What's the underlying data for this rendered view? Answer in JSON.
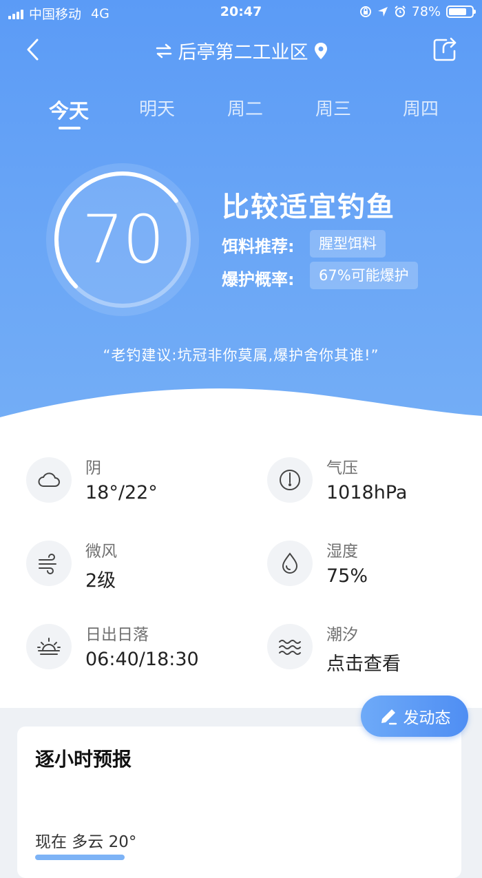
{
  "status_bar": {
    "carrier": "中国移动",
    "network": "4G",
    "time": "20:47",
    "battery": "78%",
    "battery_level": 0.78
  },
  "nav": {
    "location": "后亭第二工业区"
  },
  "tabs": [
    "今天",
    "明天",
    "周二",
    "周三",
    "周四"
  ],
  "active_tab": 0,
  "score": {
    "value": "70",
    "level": 0.7
  },
  "verdict": "比较适宜钓鱼",
  "bait": {
    "label": "饵料推荐:",
    "value": "腥型饵料"
  },
  "blank_rate": {
    "label": "爆护概率:",
    "value": "67%可能爆护"
  },
  "quote": "“老钓建议:坑冠非你莫属,爆护舍你其谁!”",
  "conditions": [
    {
      "icon": "cloud-icon",
      "label": "阴",
      "value": "18°/22°"
    },
    {
      "icon": "pressure-gauge-icon",
      "label": "气压",
      "value": "1018hPa"
    },
    {
      "icon": "wind-icon",
      "label": "微风",
      "value": "2级"
    },
    {
      "icon": "water-drop-icon",
      "label": "湿度",
      "value": "75%"
    },
    {
      "icon": "sunrise-icon",
      "label": "日出日落",
      "value": "06:40/18:30"
    },
    {
      "icon": "tide-waves-icon",
      "label": "潮汐",
      "value": "点击查看"
    }
  ],
  "fab": {
    "label": "发动态",
    "icon": "pencil-icon"
  },
  "hourly": {
    "title": "逐小时预报",
    "now": "现在 多云 20°"
  },
  "colors": {
    "primary": "#5b9bf6",
    "fab": "#4f8ef3"
  }
}
